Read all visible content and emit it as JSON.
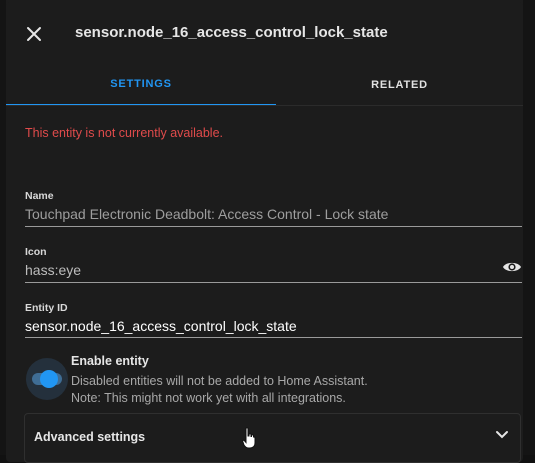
{
  "dialog": {
    "title": "sensor.node_16_access_control_lock_state",
    "close_icon": "close-icon"
  },
  "tabs": [
    {
      "label": "SETTINGS",
      "active": true
    },
    {
      "label": "RELATED",
      "active": false
    }
  ],
  "error_message": "This entity is not currently available.",
  "fields": {
    "name": {
      "label": "Name",
      "value": "Touchpad Electronic Deadbolt: Access Control - Lock state"
    },
    "icon": {
      "label": "Icon",
      "value": "hass:eye",
      "preview_icon": "eye-icon"
    },
    "entity_id": {
      "label": "Entity ID",
      "value": "sensor.node_16_access_control_lock_state"
    }
  },
  "enable_entity": {
    "label": "Enable entity",
    "enabled": true,
    "description_line1": "Disabled entities will not be added to Home Assistant.",
    "description_line2": "Note: This might not work yet with all integrations."
  },
  "advanced": {
    "label": "Advanced settings",
    "expand_icon": "chevron-down-icon"
  },
  "colors": {
    "accent": "#2196f3",
    "error": "#e04b4b",
    "surface": "#1c1c1c"
  }
}
